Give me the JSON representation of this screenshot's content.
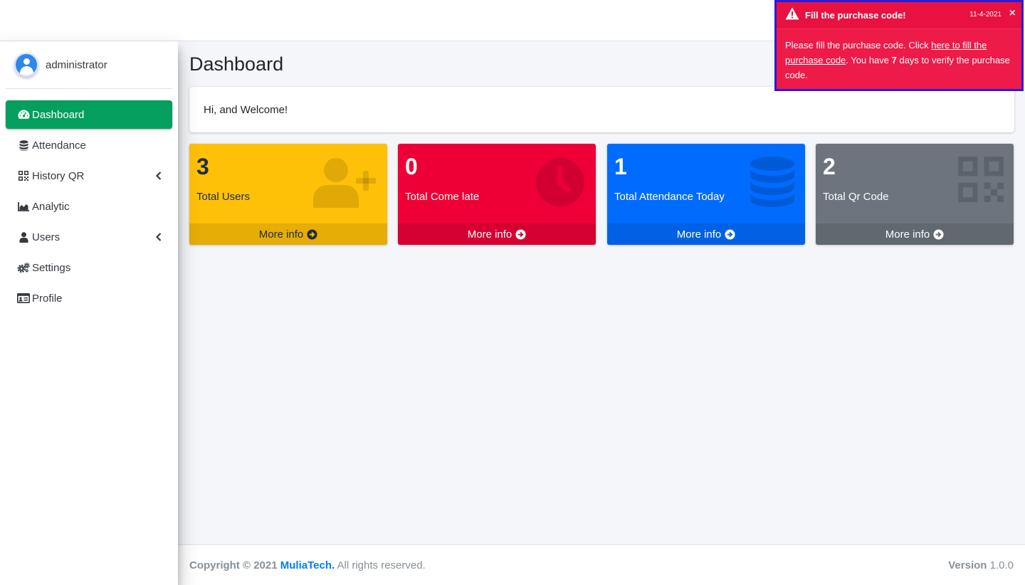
{
  "user": {
    "name": "administrator"
  },
  "sidebar": {
    "items": [
      {
        "label": "Dashboard",
        "icon": "tachometer-icon",
        "active": true
      },
      {
        "label": "Attendance",
        "icon": "database-icon"
      },
      {
        "label": "History QR",
        "icon": "qrcode-icon",
        "has_submenu": true
      },
      {
        "label": "Analytic",
        "icon": "area-chart-icon"
      },
      {
        "label": "Users",
        "icon": "user-icon",
        "has_submenu": true
      },
      {
        "label": "Settings",
        "icon": "cogs-icon"
      },
      {
        "label": "Profile",
        "icon": "id-card-icon"
      }
    ]
  },
  "main": {
    "title": "Dashboard",
    "welcome": "Hi, and Welcome!",
    "boxes": [
      {
        "value": "3",
        "label": "Total Users",
        "icon": "user-plus-icon",
        "more": "More info",
        "color": "#ffc107"
      },
      {
        "value": "0",
        "label": "Total Come late",
        "icon": "clock-icon",
        "more": "More info",
        "color": "#ee0037"
      },
      {
        "value": "1",
        "label": "Total Attendance Today",
        "icon": "database-icon",
        "more": "More info",
        "color": "#006cff"
      },
      {
        "value": "2",
        "label": "Total Qr Code",
        "icon": "qrcode-icon",
        "more": "More info",
        "color": "#6c757d"
      }
    ]
  },
  "footer": {
    "copyright": "Copyright © 2021",
    "brand": "MuliaTech.",
    "rights": "All rights reserved.",
    "version_label": "Version",
    "version": "1.0.0"
  },
  "toast": {
    "title": "Fill the purchase code!",
    "date": "11-4-2021",
    "close": "×",
    "text_before": "Please fill the purchase code. Click ",
    "link": "here to fill the purchase code",
    "text_middle": ". You have ",
    "days": "7",
    "text_after": " days to verify the purchase code."
  },
  "colors": {
    "accent_green": "#049e5e",
    "toast_red": "#ee1a48",
    "brand_blue": "#007bff"
  }
}
